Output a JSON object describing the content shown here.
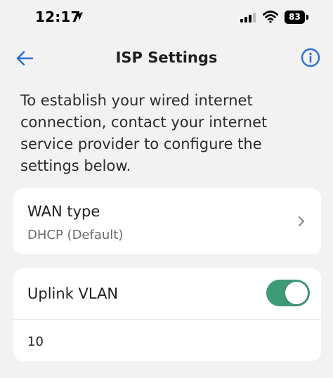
{
  "status_bar": {
    "time": "12:17",
    "battery": "83"
  },
  "header": {
    "title": "ISP Settings",
    "back_icon": "arrow-left-icon",
    "info_icon": "info-icon"
  },
  "description": "To establish your wired internet connection, contact your internet service provider to configure the settings below.",
  "wan": {
    "label": "WAN type",
    "value": "DHCP (Default)"
  },
  "uplink_vlan": {
    "label": "Uplink VLAN",
    "enabled": true,
    "vlan_id": "10"
  },
  "colors": {
    "accent": "#2b6fd6",
    "toggle_on": "#3f9a76",
    "background": "#f2f2f3",
    "card": "#ffffff"
  }
}
